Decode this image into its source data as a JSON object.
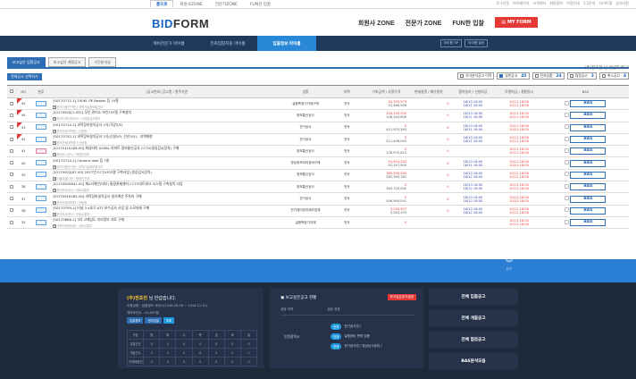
{
  "topnav": {
    "tabs": [
      "홈으로",
      "회원사ZONE",
      "전문가ZONE",
      "FUN한 입찰"
    ],
    "util": [
      "로그아웃",
      "마이페이지",
      "고객센터",
      "회원정보",
      "이용안내",
      "1:1문의",
      "사이트맵",
      "공지사항"
    ]
  },
  "header": {
    "logo_a": "BID",
    "logo_b": "FORM",
    "nav": [
      "회원사 ZONE",
      "전문가 ZONE",
      "FUN한 입찰"
    ],
    "myform": "MY FORM"
  },
  "subnav": {
    "items": [
      "예비전문가 마이룸",
      "전자입찰지원 마이룸",
      "입찰정보 마이룸"
    ],
    "active_index": 2,
    "buttons": [
      "마이룸 TIP",
      "마이룸 설정"
    ]
  },
  "tabs2": [
    "보고싶은 입찰공고",
    "보고싶은 개찰공고",
    "기간분석실"
  ],
  "greeting": "(주)전초전 님 안녕하세요!",
  "filterbar": {
    "select_all": "전체공고 선택하기",
    "filters": [
      {
        "label": "지가분석공고 이력",
        "checked": false,
        "count": ""
      },
      {
        "label": "일반공고",
        "checked": true,
        "count": "45"
      },
      {
        "label": "전자입찰",
        "checked": false,
        "count": "24"
      },
      {
        "label": "협정공고",
        "checked": false,
        "count": "3"
      },
      {
        "label": "취소공고",
        "checked": false,
        "count": "4"
      }
    ]
  },
  "table": {
    "headers": [
      "",
      "NO",
      "분류",
      "[공고번호] 공고명 / 발주기관",
      "업종",
      "지역",
      "기초금액 / 추정가격",
      "현재설명 / 예가범위",
      "협약일자 / 신청마감",
      "투찰마감 / 개찰일시",
      "BAS"
    ],
    "rows": [
      {
        "no": "45",
        "new": true,
        "cat": "blue",
        "t1": "[G0170712-1] 100KL PE Beaker 등 10종",
        "t2": "한국식품연구원 / 과학기술정보통신부",
        "biz": "실험측정기자재구매",
        "region": "전국",
        "p1": "34,333,573",
        "p2": "52,466,506",
        "ex1": "0",
        "ex2": "",
        "d1": "16/13 16:00",
        "d2": "16/11 18:00",
        "d3": "",
        "d4": "10/11 18:00"
      },
      {
        "no": "44",
        "new": true,
        "cat": "blue",
        "t1": "[20170920[1-031] 무인 관리소 보안시스템 구축설치",
        "t2": "한국지역난방공사 / 산업통상자원부",
        "biz": "정보통신공사",
        "region": "전국",
        "p1": "118,190,050",
        "p2": "108,244,606",
        "ex1": "0",
        "ex2": "",
        "d1": "16/13 16:00",
        "d2": "16/11 18:00",
        "d3": "",
        "d4": "10/11 18:00"
      },
      {
        "no": "43",
        "new": true,
        "cat": "blue",
        "t1": "[G0170714-1] 과학장비설치공사 2식(각양3/5)",
        "t2": "한국산림과학원 / 산림청",
        "biz": "전기공사",
        "region": "전국",
        "p1": "0",
        "p2": "411,925,363",
        "ex1": "0",
        "ex2": "",
        "d1": "16/13 16:00",
        "d2": "16/11 18:00",
        "d3": "",
        "d4": "10/11 18:00"
      },
      {
        "no": "42",
        "new": true,
        "cat": "blue",
        "t1": "[G0170742-1] 과학장비설치공사 2식(신설5/5, 선신5/5) - 지역제한",
        "t2": "한국산림과학원 / 산림청",
        "biz": "전기공사",
        "region": "전국",
        "p1": "0",
        "p2": "511,446,045",
        "ex1": "0",
        "ex2": "",
        "d1": "16/13 16:00",
        "d2": "16/11 18:00",
        "d3": "",
        "d4": "10/11 18:00"
      },
      {
        "no": "41",
        "new": false,
        "cat": "pink",
        "t1": "[20170110189-00] 화성터미 A20BL 아파트 정보통신공사 CCTV(영상감시장치) 구매",
        "t2": "화성도시공사 / 행정안전부",
        "biz": "정보통신공사",
        "region": "전국",
        "p1": "0",
        "p2": "178,970,810",
        "ex1": "0",
        "ex2": "",
        "d1": "",
        "d2": "",
        "d3": "",
        "d4": "10/11 18:00"
      },
      {
        "no": "40",
        "new": false,
        "cat": "blue",
        "t1": "[G0170714-1] Camera Idiel 등 7종",
        "t2": "한국식품연구원 / 과학기술정보통신부",
        "biz": "영상정보처리장비구매",
        "region": "전국",
        "p1": "43,924,242",
        "p2": "55,147,505",
        "ex1": "0",
        "ex2": "",
        "d1": "16/13 16:00",
        "d2": "16/11 18:00",
        "d3": "",
        "d4": "10/11 18:00"
      },
      {
        "no": "39",
        "new": false,
        "cat": "blue",
        "t1": "[20170922[67-00] 2017년 CCTV시스템 구축사업 (영상감시장치)",
        "t2": "서울특별시청 / 행정안전부",
        "biz": "정보통신공사",
        "region": "전국",
        "p1": "389,000,000",
        "p2": "285,390,182",
        "ex1": "0",
        "ex2": "",
        "d1": "16/13 16:00",
        "d2": "16/12 18:00",
        "d3": "",
        "d4": "10/12 18:00"
      },
      {
        "no": "38",
        "new": false,
        "cat": "blue",
        "t1": "[20170920641-00] 제2서해안(대부) 통합관제센터 CCTV네트워크 시스템 구축설치 사업",
        "t2": "한국도로공사 / 국토교통부",
        "biz": "정보통신공사",
        "region": "전국",
        "p1": "0",
        "p2": "365,720,000",
        "ex1": "0",
        "ex2": "",
        "d1": "16/13 16:00",
        "d2": "16/12 18:00",
        "d3": "",
        "d4": "10/12 18:00"
      },
      {
        "no": "37",
        "new": false,
        "cat": "blue",
        "t1": "[20170916185-00] 과학장비설치공사 설치계산 주차비 구매",
        "t2": "한국산림과학원 / 산림청",
        "biz": "전기공사",
        "region": "전국",
        "p1": "0",
        "p2": "546,949,091",
        "ex1": "0",
        "ex2": "",
        "d1": "16/13 16:00",
        "d2": "16/12 18:00",
        "d3": "",
        "d4": "10/12 18:00"
      },
      {
        "no": "36",
        "new": false,
        "cat": "blue",
        "t1": "[G0170759-1] 터널 3.4호기 ATT 보수공사 사업 및 소모자재 구매",
        "t2": "한국도로공사 / 국토교통부",
        "biz": "전기제어장치제조업체",
        "region": "전국",
        "p1": "3,290,927",
        "p2": "3,053,193",
        "ex1": "0",
        "ex2": "",
        "d1": "16/13 16:00",
        "d2": "16/12 18:00",
        "d3": "",
        "d4": "10/12 18:00"
      },
      {
        "no": "35",
        "new": false,
        "cat": "blue",
        "t1": "[G0170866-1] 3차 고해상도 지리정보 자료 구매",
        "t2": "국토지리정보원 / 국토교통부",
        "biz": "실험측정기자재",
        "region": "전국",
        "p1": "0",
        "p2": "",
        "ex1": "",
        "ex2": "",
        "d1": "",
        "d2": "",
        "d3": "",
        "d4": "10/12 18:00"
      }
    ],
    "bas_label": "BAS"
  },
  "footer": {
    "chev_label": "닫기",
    "panel1": {
      "title_name": "(주)전초전",
      "title_rest": " 님 반갑습니다.",
      "line1_label": "이용상품",
      "line1_value": "입찰정보 서비스(2016.09.06 ~ 2018.12.31)",
      "line2_label": "예치포인트",
      "line2_value": "10,000점",
      "pills": [
        "입찰정보",
        "전자입찰",
        "조회"
      ],
      "grid_header": [
        "구분",
        "월",
        "화",
        "수",
        "목",
        "금",
        "토",
        "일"
      ],
      "grid_rows": [
        "입찰건수",
        "개찰건수",
        "전체예정건"
      ]
    },
    "panel2": {
      "title": "보고싶은공고 현황",
      "redbtn": "보고싶은공고설정",
      "col1": "설정 지역",
      "col2": "설정 업종",
      "region": "인천광역시",
      "tags": [
        {
          "k": "전체",
          "v": "전기공사업 / "
        },
        {
          "k": "전체",
          "v": "실험장비 면허 업종"
        },
        {
          "k": "전체",
          "v": "전기공사업 / 영상감시장치 / "
        }
      ]
    },
    "panel3": [
      "전체 입찰공고",
      "전체 개찰공고",
      "전체 협정공고",
      "BAS분석모음"
    ]
  }
}
